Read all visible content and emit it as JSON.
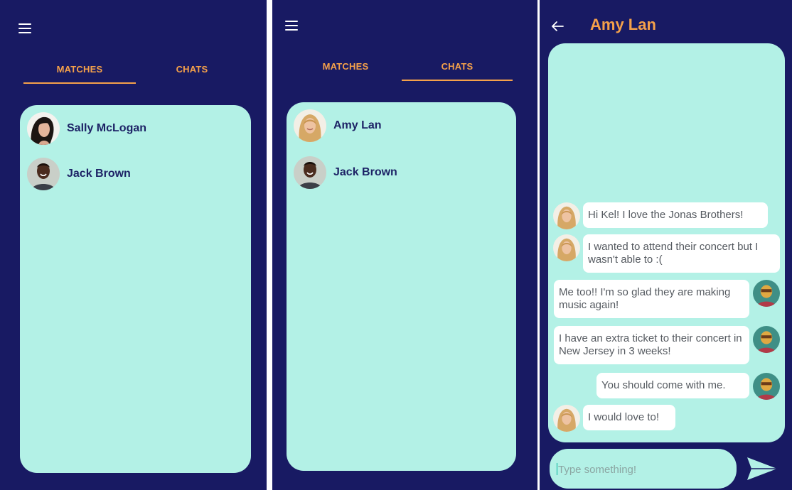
{
  "tabs": {
    "matches": "MATCHES",
    "chats": "CHATS"
  },
  "matches_list": [
    "Sally McLogan",
    "Jack Brown"
  ],
  "chats_list": [
    "Amy Lan",
    "Jack Brown"
  ],
  "chat": {
    "title": "Amy Lan",
    "messages": [
      {
        "from": "them",
        "text": "Hi Kel! I love the Jonas Brothers!"
      },
      {
        "from": "them",
        "text": "I wanted to attend their concert but I wasn't able to :("
      },
      {
        "from": "me",
        "text": "Me too!! I'm so glad they are making music again!"
      },
      {
        "from": "me",
        "text": "I have an extra ticket to their concert in New Jersey in 3 weeks!"
      },
      {
        "from": "me",
        "text": "You should come with me."
      },
      {
        "from": "them",
        "text": "I would love to!"
      }
    ],
    "input_placeholder": "Type something!"
  },
  "icons": {
    "menu": "hamburger-menu-icon",
    "back": "arrow-left-icon",
    "send": "send-icon"
  },
  "colors": {
    "background": "#181a63",
    "card": "#b3f1e6",
    "accent": "#f5a14a",
    "name_text": "#1d2366",
    "bubble": "#ffffff"
  }
}
